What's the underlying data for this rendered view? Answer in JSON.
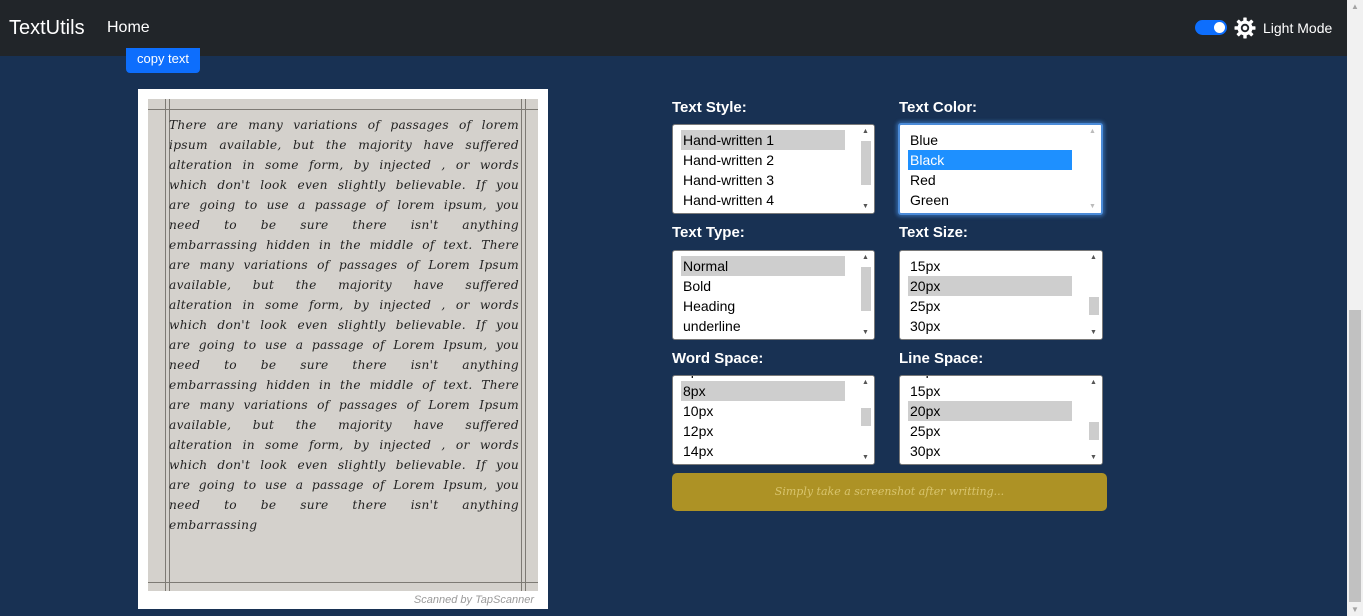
{
  "navbar": {
    "brand": "TextUtils",
    "home": "Home",
    "mode_label": "Light Mode",
    "toggle_on": true
  },
  "copy_button": "copy text",
  "paper": {
    "text": "There are many variations of passages of lorem ipsum available, but the majority have suffered alteration in some form, by injected , or words which don't look even slightly believable. If you are going to use a passage of lorem ipsum, you need to be sure there isn't anything embarrassing hidden in the middle of text. There are many variations of passages of Lorem Ipsum available, but the majority have suffered alteration in some form, by injected , or words which don't look even slightly believable. If you are going to use a passage of Lorem Ipsum, you need to be sure there isn't anything embarrassing hidden in the middle of text. There are many variations of passages of Lorem Ipsum available, but the majority have suffered alteration in some form, by injected , or words which don't look even slightly believable. If you are going to use a passage of Lorem Ipsum, you need to be sure there isn't anything embarrassing",
    "watermark": "Scanned by TapScanner"
  },
  "controls": {
    "text_style": {
      "label": "Text Style:",
      "options": [
        "Hand-written 1",
        "Hand-written 2",
        "Hand-written 3",
        "Hand-written 4"
      ],
      "selected": "Hand-written 1"
    },
    "text_color": {
      "label": "Text Color:",
      "options": [
        "Blue",
        "Black",
        "Red",
        "Green"
      ],
      "selected": "Black"
    },
    "text_type": {
      "label": "Text Type:",
      "options": [
        "Normal",
        "Bold",
        "Heading",
        "underline"
      ],
      "selected": "Normal"
    },
    "text_size": {
      "label": "Text Size:",
      "options": [
        "15px",
        "20px",
        "25px",
        "30px"
      ],
      "selected": "20px"
    },
    "word_space": {
      "label": "Word Space:",
      "options": [
        "8px",
        "10px",
        "12px",
        "14px"
      ],
      "selected": "8px"
    },
    "line_space": {
      "label": "Line Space:",
      "options": [
        "15px",
        "20px",
        "25px",
        "30px"
      ],
      "selected": "20px"
    }
  },
  "screenshot_button": "Simply take a screenshot after writting...",
  "colors": {
    "page_bg": "#183153",
    "navbar_bg": "#212529",
    "primary": "#0d6efd",
    "screenshot_btn_bg": "#ad9225"
  }
}
